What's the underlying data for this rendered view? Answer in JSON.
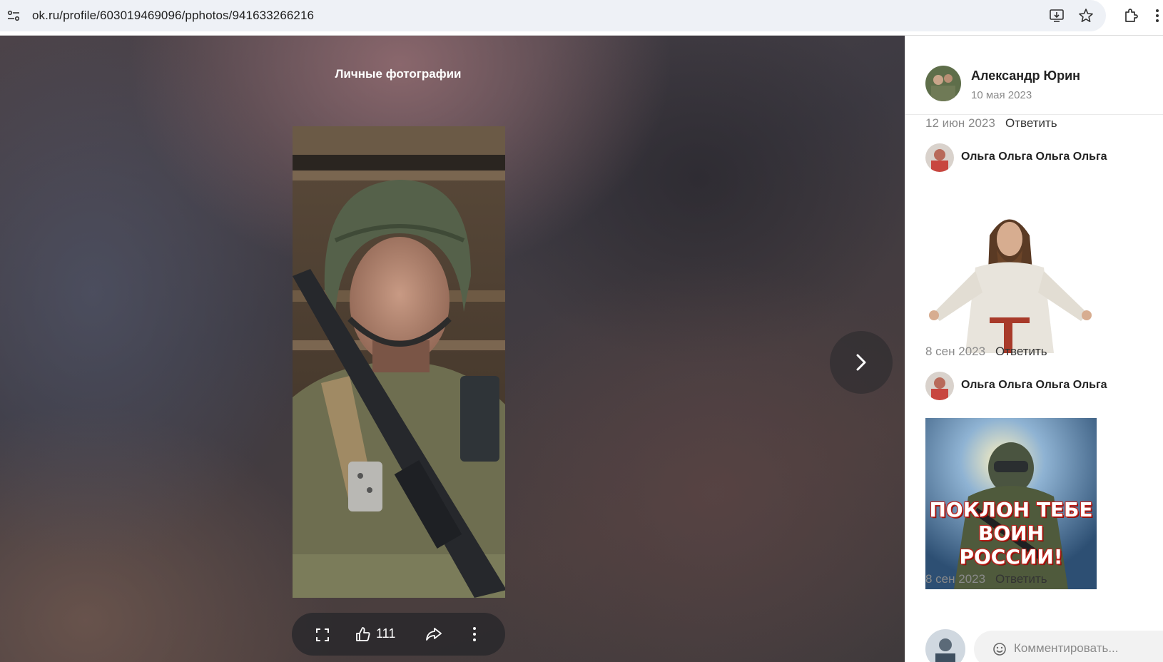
{
  "browser": {
    "url": "ok.ru/profile/603019469096/pphotos/941633266216",
    "icons": [
      "site-info-icon",
      "install-app-icon",
      "star-icon",
      "extensions-icon",
      "more-vert-icon"
    ]
  },
  "viewer": {
    "album_title": "Личные фотографии",
    "likes": "111",
    "icons": [
      "fullscreen-icon",
      "like-icon",
      "share-icon",
      "menu-icon",
      "chevron-right-icon"
    ]
  },
  "author": {
    "name": "Александр Юрин",
    "date": "10 мая 2023"
  },
  "comments": [
    {
      "date": "12 июн 2023",
      "reply": "Ответить"
    },
    {
      "name": "Ольга Ольга Ольга Ольга",
      "date": "8 сен 2023",
      "reply": "Ответить",
      "sticker": "jesus"
    },
    {
      "name": "Ольга Ольга Ольга Ольга",
      "date": "8 сен 2023",
      "reply": "Ответить",
      "sticker": "soldier",
      "sticker_text": [
        "ПОКЛОН ТЕБЕ",
        "ВОИН РОССИИ!"
      ]
    }
  ],
  "comment_input": {
    "placeholder": "Комментировать..."
  },
  "colors": {
    "panel_bg": "#ffffff",
    "viewer_bg": "#3d3a42",
    "text_dark": "#222222",
    "text_muted": "#8a8a8a"
  }
}
